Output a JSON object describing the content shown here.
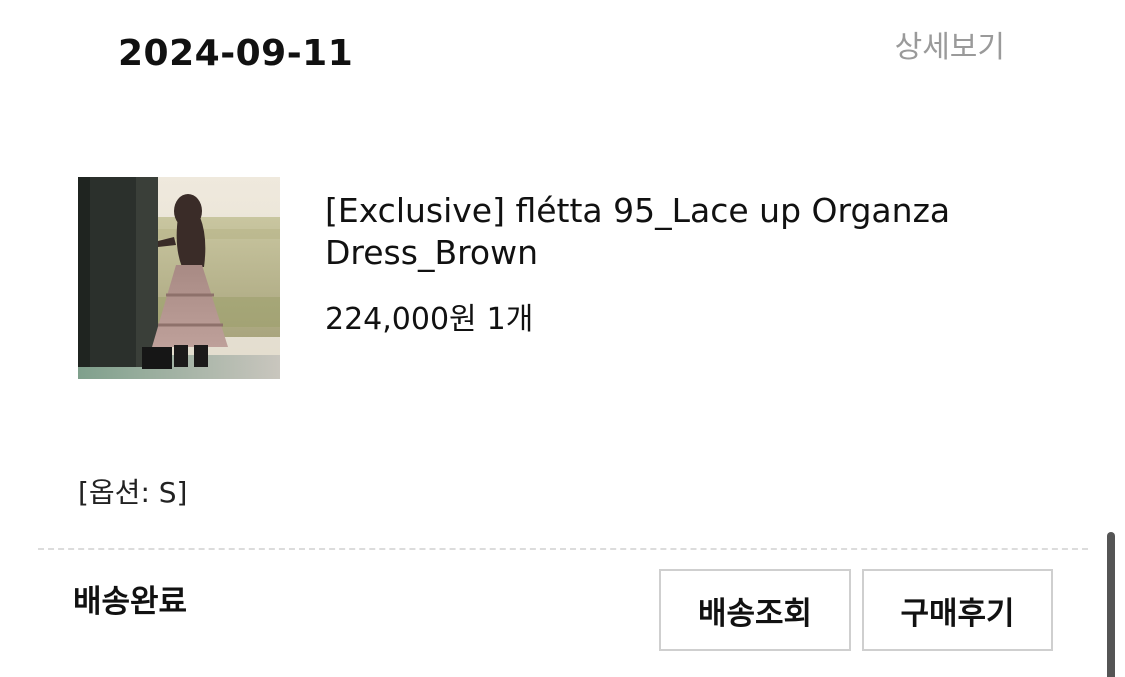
{
  "order": {
    "date": "2024-09-11",
    "detail_link": "상세보기"
  },
  "product": {
    "name": "[Exclusive] flétta 95_Lace up Organza Dress_Brown",
    "price": "224,000원",
    "quantity": "1개",
    "option": "[옵션: S]",
    "thumbnail_icon": "product-photo"
  },
  "shipping": {
    "status": "배송완료",
    "track_button": "배송조회",
    "review_button": "구매후기"
  }
}
